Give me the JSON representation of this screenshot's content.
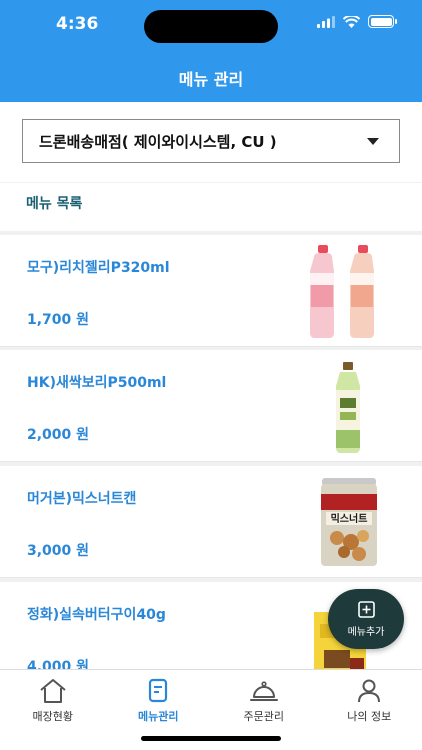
{
  "status_bar": {
    "time": "4:36"
  },
  "header": {
    "title": "메뉴 관리"
  },
  "store_selector": {
    "value": "드론배송매점( 제이와이시스템, CU )"
  },
  "section": {
    "title": "메뉴 목록"
  },
  "menu_items": [
    {
      "name": "모구)리치젤리P320ml",
      "price": "1,700 원"
    },
    {
      "name": "HK)새싹보리P500ml",
      "price": "2,000 원"
    },
    {
      "name": "머거본)믹스너트캔",
      "price": "3,000 원"
    },
    {
      "name": "정화)실속버터구이40g",
      "price": "4,000 원"
    }
  ],
  "product_label": "믹스너트",
  "fab": {
    "label": "메뉴추가"
  },
  "tabs": [
    {
      "label": "매장현황",
      "icon": "home-icon"
    },
    {
      "label": "메뉴관리",
      "icon": "menu-doc-icon"
    },
    {
      "label": "주문관리",
      "icon": "cloche-icon"
    },
    {
      "label": "나의 정보",
      "icon": "person-icon"
    }
  ],
  "colors": {
    "accent": "#2f97ec",
    "price": "#2a87d8",
    "fab": "#1f3a3b"
  }
}
